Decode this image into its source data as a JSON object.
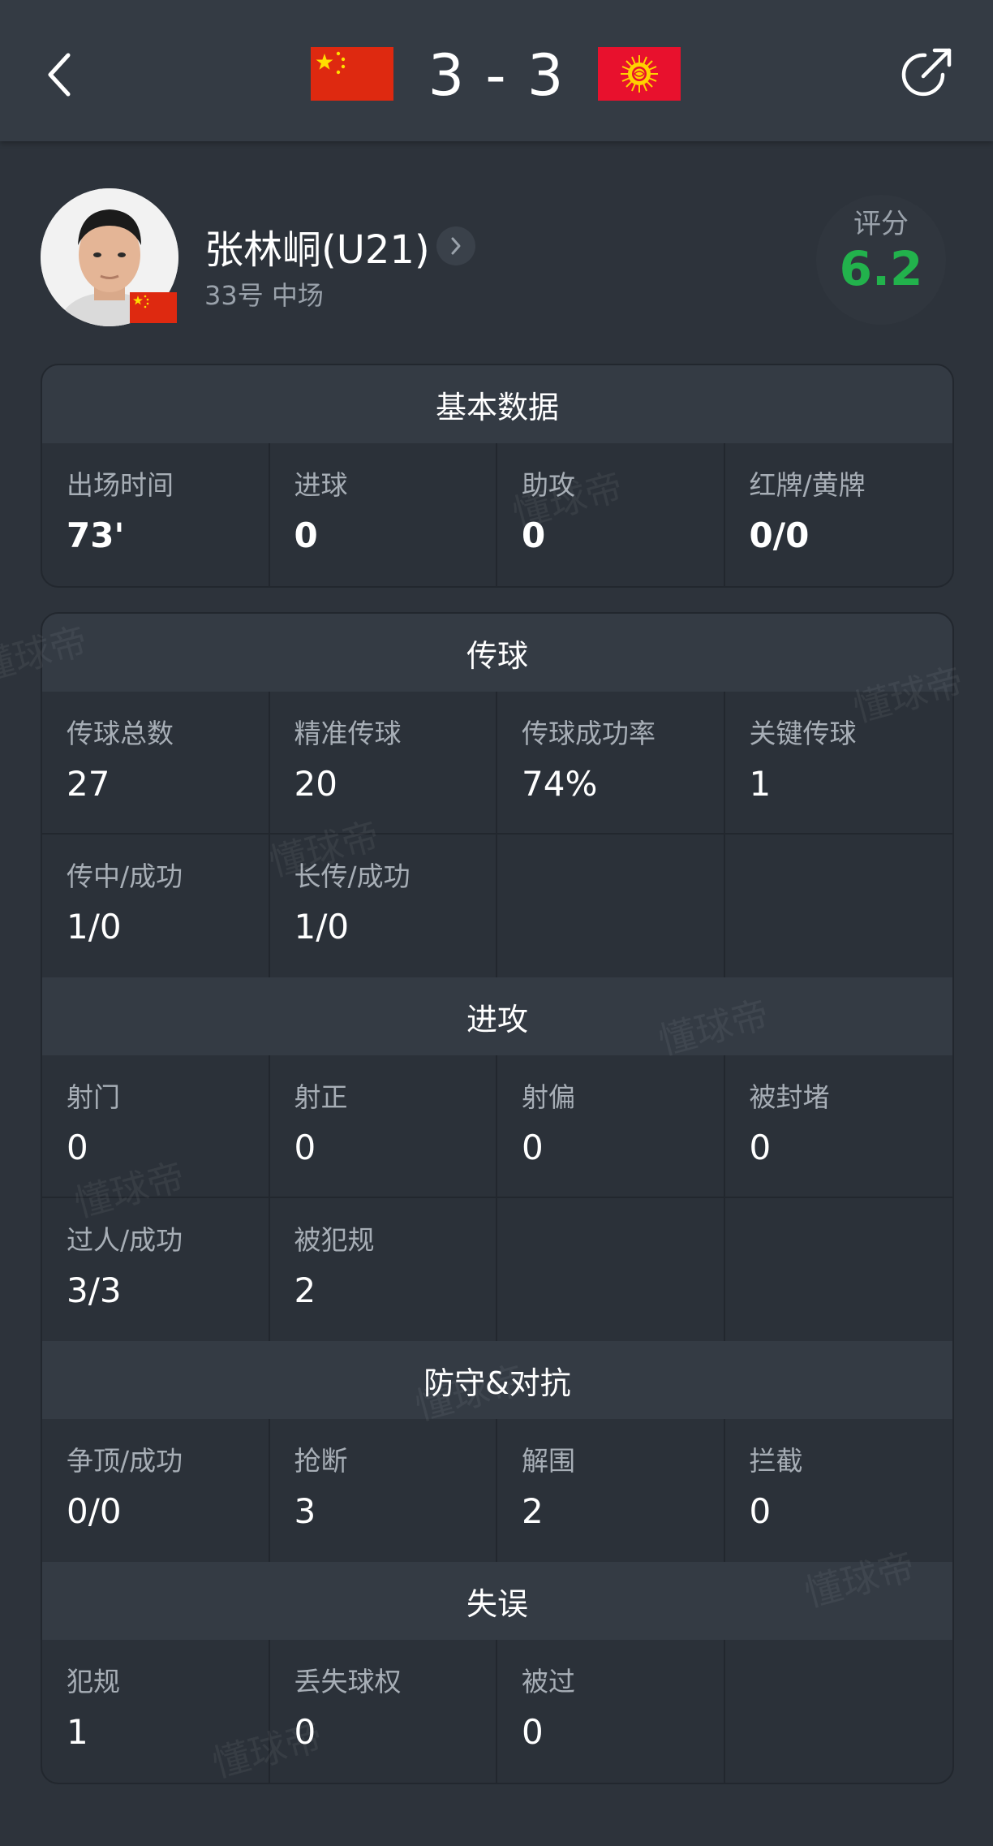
{
  "header": {
    "score": "3 - 3",
    "home_flag": "china-flag",
    "away_flag": "kyrgyzstan-flag"
  },
  "player": {
    "name": "张林峒(U21)",
    "subtitle": "33号 中场",
    "rating_label": "评分",
    "rating_value": "6.2"
  },
  "sections": [
    {
      "title": "基本数据",
      "stats": [
        {
          "label": "出场时间",
          "value": "73'"
        },
        {
          "label": "进球",
          "value": "0"
        },
        {
          "label": "助攻",
          "value": "0"
        },
        {
          "label": "红牌/黄牌",
          "value": "0/0"
        }
      ]
    },
    {
      "title": "传球",
      "stats": [
        {
          "label": "传球总数",
          "value": "27"
        },
        {
          "label": "精准传球",
          "value": "20"
        },
        {
          "label": "传球成功率",
          "value": "74%"
        },
        {
          "label": "关键传球",
          "value": "1"
        },
        {
          "label": "传中/成功",
          "value": "1/0"
        },
        {
          "label": "长传/成功",
          "value": "1/0"
        }
      ]
    },
    {
      "title": "进攻",
      "stats": [
        {
          "label": "射门",
          "value": "0"
        },
        {
          "label": "射正",
          "value": "0"
        },
        {
          "label": "射偏",
          "value": "0"
        },
        {
          "label": "被封堵",
          "value": "0"
        },
        {
          "label": "过人/成功",
          "value": "3/3"
        },
        {
          "label": "被犯规",
          "value": "2"
        }
      ]
    },
    {
      "title": "防守&对抗",
      "stats": [
        {
          "label": "争顶/成功",
          "value": "0/0"
        },
        {
          "label": "抢断",
          "value": "3"
        },
        {
          "label": "解围",
          "value": "2"
        },
        {
          "label": "拦截",
          "value": "0"
        }
      ]
    },
    {
      "title": "失误",
      "stats": [
        {
          "label": "犯规",
          "value": "1"
        },
        {
          "label": "丢失球权",
          "value": "0"
        },
        {
          "label": "被过",
          "value": "0"
        }
      ]
    }
  ],
  "watermark": "懂球帝",
  "colors": {
    "background": "#2d333b",
    "rating": "#22b24c",
    "china_red": "#de2910",
    "kyrgyz_red": "#e8112d",
    "kyrgyz_sun": "#ffd200"
  }
}
